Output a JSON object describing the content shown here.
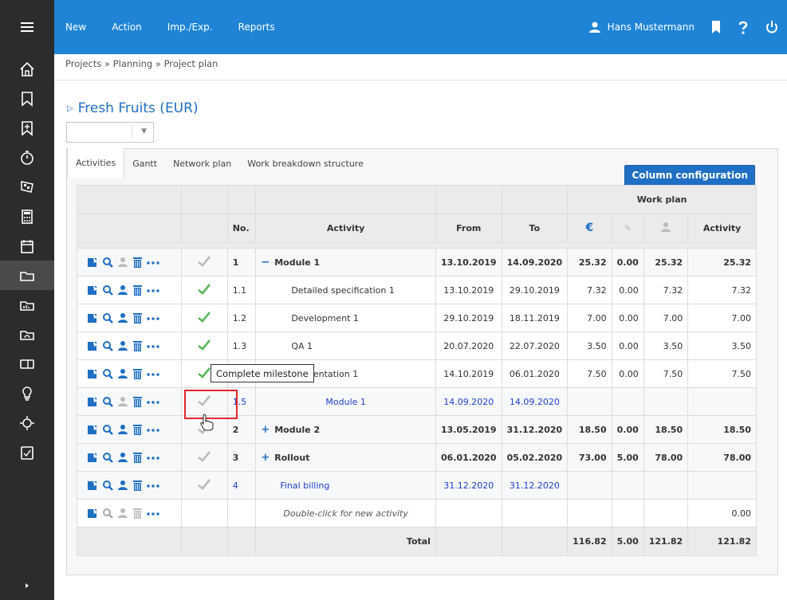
{
  "topbar": {
    "menu": [
      "New",
      "Action",
      "Imp./Exp.",
      "Reports"
    ],
    "user": "Hans Mustermann"
  },
  "breadcrumb": "Projects » Planning » Project plan",
  "project_title": "Fresh Fruits (EUR)",
  "tabs": [
    "Activities",
    "Gantt",
    "Network plan",
    "Work breakdown structure"
  ],
  "column_config_label": "Column configuration",
  "grid": {
    "group_header": "Work plan",
    "headers": {
      "no": "No.",
      "activity": "Activity",
      "from": "From",
      "to": "To",
      "activity2": "Activity"
    },
    "rows": [
      {
        "no": "1",
        "name": "Module 1",
        "prefix": "−",
        "from": "13.10.2019",
        "to": "14.09.2020",
        "eur": "25.32",
        "w2": "0.00",
        "w3": "25.32",
        "act": "25.32"
      },
      {
        "no": "1.1",
        "name": "Detailed specification 1",
        "from": "13.10.2019",
        "to": "29.10.2019",
        "eur": "7.32",
        "w2": "0.00",
        "w3": "7.32",
        "act": "7.32"
      },
      {
        "no": "1.2",
        "name": "Development 1",
        "from": "29.10.2019",
        "to": "18.11.2019",
        "eur": "7.00",
        "w2": "0.00",
        "w3": "7.00",
        "act": "7.00"
      },
      {
        "no": "1.3",
        "name": "QA 1",
        "from": "20.07.2020",
        "to": "22.07.2020",
        "eur": "3.50",
        "w2": "0.00",
        "w3": "3.50",
        "act": "3.50"
      },
      {
        "no": "",
        "name": "plementation 1",
        "from": "14.10.2019",
        "to": "06.01.2020",
        "eur": "7.50",
        "w2": "0.00",
        "w3": "7.50",
        "act": "7.50"
      },
      {
        "no": "1.5",
        "name": "Module 1",
        "from": "14.09.2020",
        "to": "14.09.2020",
        "eur": "",
        "w2": "",
        "w3": "",
        "act": ""
      },
      {
        "no": "2",
        "name": "Module 2",
        "prefix": "+",
        "from": "13.05.2019",
        "to": "31.12.2020",
        "eur": "18.50",
        "w2": "0.00",
        "w3": "18.50",
        "act": "18.50"
      },
      {
        "no": "3",
        "name": "Rollout",
        "prefix": "+",
        "from": "06.01.2020",
        "to": "05.02.2020",
        "eur": "73.00",
        "w2": "5.00",
        "w3": "78.00",
        "act": "78.00"
      },
      {
        "no": "4",
        "name": "Final billing",
        "from": "31.12.2020",
        "to": "31.12.2020",
        "eur": "",
        "w2": "",
        "w3": "",
        "act": ""
      },
      {
        "no": "",
        "name": "Double-click for new activity",
        "from": "",
        "to": "",
        "eur": "",
        "w2": "",
        "w3": "",
        "act": "0.00"
      }
    ],
    "total": {
      "label": "Total",
      "eur": "116.82",
      "w2": "5.00",
      "w3": "121.82",
      "act": "121.82"
    }
  },
  "tooltip": "Complete milestone",
  "colors": {
    "sidebar": "#2c2c2c",
    "topbar": "#1f84d6",
    "accent": "#1f6fc4",
    "check_green": "#5cb85c",
    "highlight": "#e3262b"
  }
}
